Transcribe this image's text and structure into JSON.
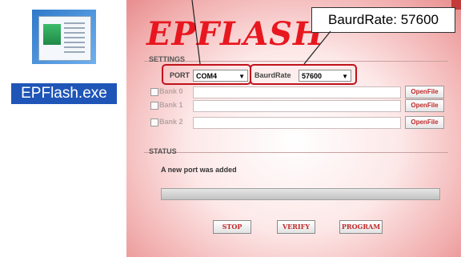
{
  "desktop": {
    "icon_label": "EPFlash.exe",
    "icon_name": "application-window-icon"
  },
  "app": {
    "logo": "EPFLASH",
    "settings_label": "SETTINGS",
    "port": {
      "label": "PORT",
      "value": "COM4"
    },
    "baud": {
      "label": "BaurdRate",
      "value": "57600"
    },
    "banks": [
      {
        "label": "Bank 0",
        "button": "OpenFile"
      },
      {
        "label": "Bank 1",
        "button": "OpenFile"
      },
      {
        "label": "Bank 2",
        "button": "OpenFile"
      }
    ],
    "status_label": "STATUS",
    "status_message": "A new port was added",
    "progress": 0,
    "buttons": {
      "stop": "STOP",
      "verify": "VERIFY",
      "program": "PROGRAM"
    }
  },
  "callout": {
    "text": "BaurdRate: 57600"
  },
  "colors": {
    "accent": "#e8171f",
    "highlight": "#c0121b",
    "desktop_selection": "#1f55b7"
  }
}
